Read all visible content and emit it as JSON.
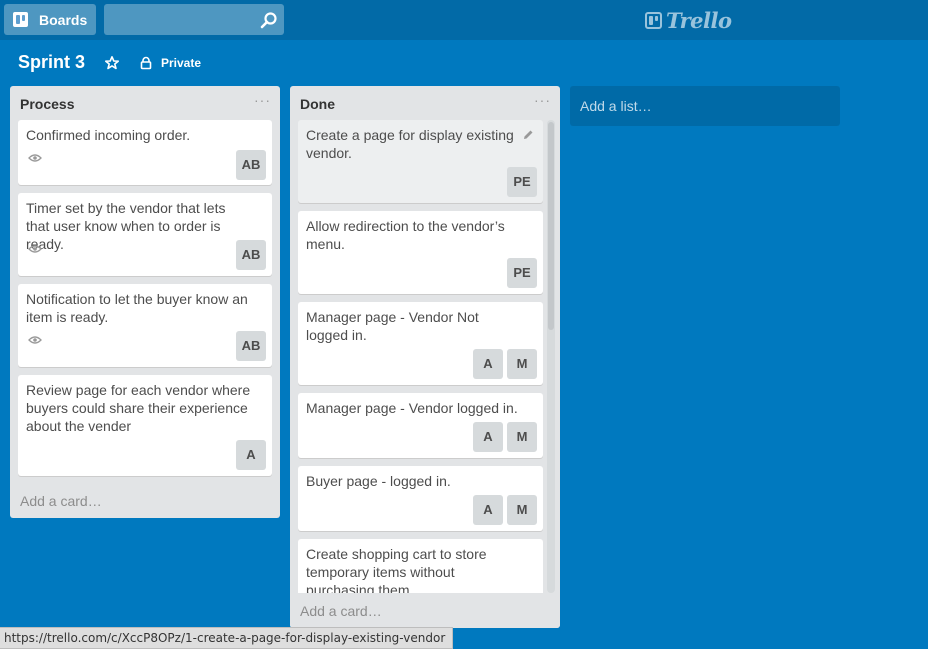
{
  "header": {
    "boards_label": "Boards",
    "search_placeholder": "",
    "logo_text": "Trello"
  },
  "board": {
    "title": "Sprint 3",
    "privacy_label": "Private"
  },
  "lists": [
    {
      "title": "Process",
      "menu": "···",
      "add_card": "Add a card…",
      "cards": [
        {
          "text": "Confirmed incoming order.",
          "watching": true,
          "members": [
            "AB"
          ]
        },
        {
          "text": "Timer set by the vendor that lets that user know when to order is ready.",
          "watching": true,
          "members": [
            "AB"
          ]
        },
        {
          "text": "Notification to let the buyer know an item is ready.",
          "watching": true,
          "members": [
            "AB"
          ]
        },
        {
          "text": "Review page for each vendor where buyers could share their experience about the vender",
          "watching": false,
          "members": [
            "A"
          ]
        }
      ]
    },
    {
      "title": "Done",
      "menu": "···",
      "add_card": "Add a card…",
      "cards": [
        {
          "text": "Create a page for display existing vendor.",
          "members": [
            "PE"
          ]
        },
        {
          "text": "Allow redirection to the vendor’s menu.",
          "members": [
            "PE"
          ]
        },
        {
          "text": "Manager page - Vendor Not logged in.",
          "members": [
            "A",
            "M"
          ]
        },
        {
          "text": "Manager page - Vendor logged in.",
          "members": [
            "A",
            "M"
          ]
        },
        {
          "text": "Buyer page - logged in.",
          "members": [
            "A",
            "M"
          ]
        },
        {
          "text": "Create shopping cart to store temporary items without purchasing them",
          "members": []
        }
      ]
    }
  ],
  "add_list_label": "Add a list…",
  "status_bar_url": "https://trello.com/c/XccP8OPz/1-create-a-page-for-display-existing-vendor",
  "colors": {
    "board_bg": "#0079bf",
    "header_bg": "#026aa7",
    "list_bg": "#e2e4e6",
    "member_bg": "#d6dadc"
  }
}
